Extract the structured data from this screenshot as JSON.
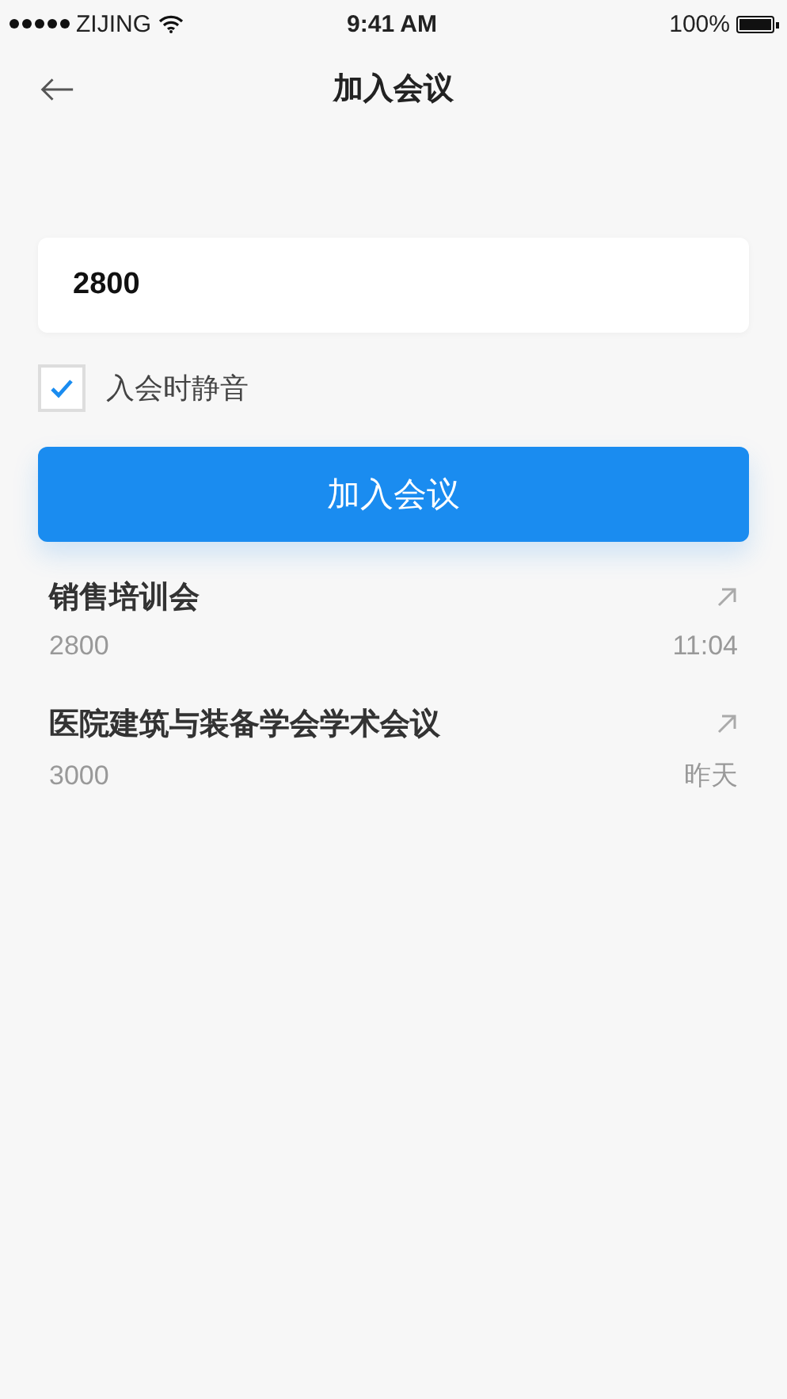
{
  "status_bar": {
    "carrier": "ZIJING",
    "time": "9:41 AM",
    "battery": "100%"
  },
  "nav": {
    "title": "加入会议"
  },
  "meeting_field": {
    "value": "2800"
  },
  "mute_option": {
    "label": "入会时静音",
    "checked": true
  },
  "join_button": {
    "label": "加入会议"
  },
  "recent_meetings": [
    {
      "name": "销售培训会",
      "number": "2800",
      "time": "11:04"
    },
    {
      "name": "医院建筑与装备学会学术会议",
      "number": "3000",
      "time": "昨天"
    }
  ]
}
